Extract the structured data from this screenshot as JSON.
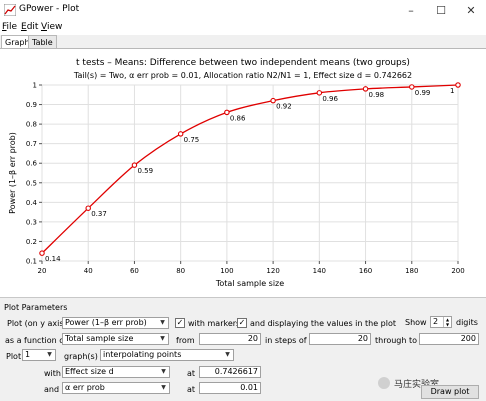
{
  "window": {
    "title": "GPower - Plot"
  },
  "menu": {
    "items": [
      {
        "acc": "F",
        "rest": "ile"
      },
      {
        "acc": "E",
        "rest": "dit"
      },
      {
        "acc": "V",
        "rest": "iew"
      }
    ]
  },
  "tabs": [
    "Graph",
    "Table"
  ],
  "plot": {
    "title": "t tests – Means: Difference between two independent means (two groups)",
    "subtitle": "Tail(s) = Two, α err prob = 0.01, Allocation ratio N2/N1 = 1, Effect size d = 0.742662"
  },
  "chart_data": {
    "type": "line",
    "xlabel": "Total sample size",
    "ylabel": "Power (1–β err prob)",
    "xlim": [
      20,
      200
    ],
    "ylim": [
      0.1,
      1.0
    ],
    "xticks": [
      20,
      40,
      60,
      80,
      100,
      120,
      140,
      160,
      180,
      200
    ],
    "yticks": [
      0.1,
      0.2,
      0.3,
      0.4,
      0.5,
      0.6,
      0.7,
      0.8,
      0.9,
      1
    ],
    "grid": true,
    "markers": true,
    "series": [
      {
        "color": "#e00000",
        "x": [
          20,
          40,
          60,
          80,
          100,
          120,
          140,
          160,
          180,
          200
        ],
        "y": [
          0.14,
          0.37,
          0.59,
          0.75,
          0.86,
          0.92,
          0.96,
          0.98,
          0.99,
          1
        ],
        "labels": [
          "0.14",
          "0.37",
          "0.59",
          "0.75",
          "0.86",
          "0.92",
          "0.96",
          "0.98",
          "0.99",
          "1"
        ]
      }
    ]
  },
  "params": {
    "heading": "Plot Parameters",
    "plot_on_y_label": "Plot (on y axis)",
    "plot_on_y_value": "Power (1–β err prob)",
    "with_markers_label": "with markers",
    "with_markers_checked": true,
    "display_values_label": "and displaying the values in the plot",
    "display_values_checked": true,
    "show_label": "Show",
    "digits_value": "2",
    "digits_label": "digits",
    "function_label": "as a function of",
    "function_value": "Total sample size",
    "from_label": "from",
    "from_value": "20",
    "steps_label": "in steps of",
    "steps_value": "20",
    "through_label": "through to",
    "through_value": "200",
    "plot_label": "Plot",
    "plot_count": "1",
    "graphs_label": "graph(s)",
    "graph_style": "interpolating points",
    "with_label": "with",
    "with_value": "Effect size d",
    "at_label": "at",
    "at_value": "0.7426617",
    "and_label": "and",
    "and_value": "α err prob",
    "at2_label": "at",
    "at2_value": "0.01",
    "draw_button": "Draw plot",
    "watermark": "马庄实验室"
  }
}
